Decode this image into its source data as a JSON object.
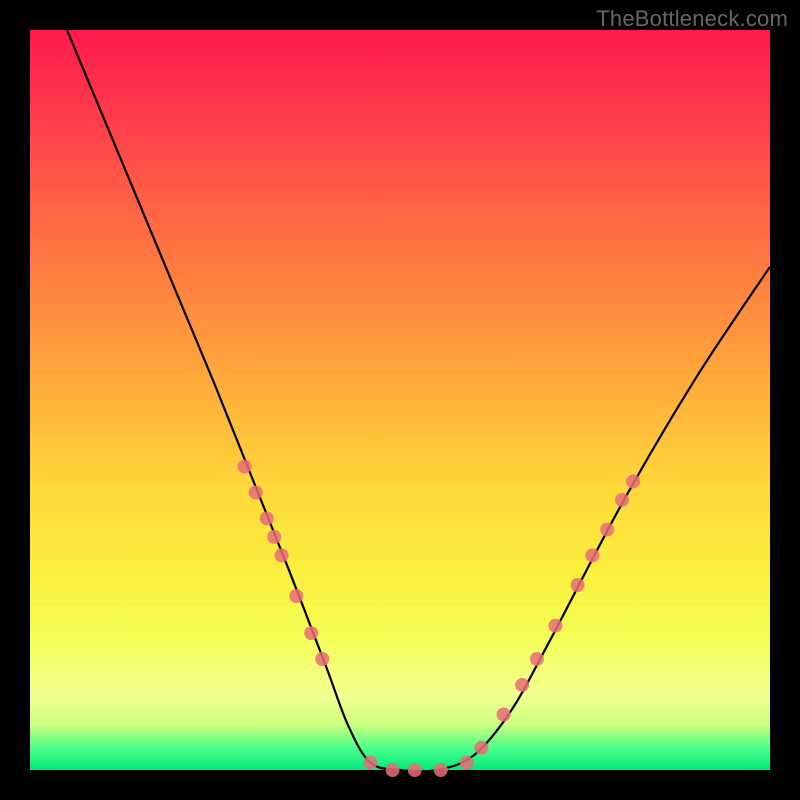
{
  "watermark": "TheBottleneck.com",
  "chart_data": {
    "type": "line",
    "title": "",
    "xlabel": "",
    "ylabel": "",
    "xlim": [
      0,
      1
    ],
    "ylim": [
      0,
      1
    ],
    "series": [
      {
        "name": "bottleneck-curve",
        "x": [
          0.05,
          0.1,
          0.15,
          0.2,
          0.25,
          0.3,
          0.35,
          0.4,
          0.43,
          0.46,
          0.5,
          0.55,
          0.6,
          0.65,
          0.7,
          0.8,
          0.9,
          1.0
        ],
        "y": [
          1.0,
          0.88,
          0.76,
          0.64,
          0.52,
          0.395,
          0.27,
          0.14,
          0.06,
          0.01,
          0.0,
          0.0,
          0.02,
          0.08,
          0.17,
          0.36,
          0.53,
          0.68
        ],
        "color": "#000000"
      }
    ],
    "markers": {
      "name": "curve-dots",
      "color": "#e96b78",
      "opacity": 0.85,
      "radius": 7,
      "points": [
        {
          "x": 0.29,
          "y": 0.41
        },
        {
          "x": 0.305,
          "y": 0.375
        },
        {
          "x": 0.32,
          "y": 0.34
        },
        {
          "x": 0.33,
          "y": 0.315
        },
        {
          "x": 0.34,
          "y": 0.29
        },
        {
          "x": 0.36,
          "y": 0.235
        },
        {
          "x": 0.38,
          "y": 0.185
        },
        {
          "x": 0.395,
          "y": 0.15
        },
        {
          "x": 0.46,
          "y": 0.01
        },
        {
          "x": 0.49,
          "y": 0.0
        },
        {
          "x": 0.52,
          "y": 0.0
        },
        {
          "x": 0.555,
          "y": 0.0
        },
        {
          "x": 0.59,
          "y": 0.01
        },
        {
          "x": 0.61,
          "y": 0.03
        },
        {
          "x": 0.64,
          "y": 0.075
        },
        {
          "x": 0.665,
          "y": 0.115
        },
        {
          "x": 0.685,
          "y": 0.15
        },
        {
          "x": 0.71,
          "y": 0.195
        },
        {
          "x": 0.74,
          "y": 0.25
        },
        {
          "x": 0.76,
          "y": 0.29
        },
        {
          "x": 0.78,
          "y": 0.325
        },
        {
          "x": 0.8,
          "y": 0.365
        },
        {
          "x": 0.815,
          "y": 0.39
        }
      ]
    }
  }
}
